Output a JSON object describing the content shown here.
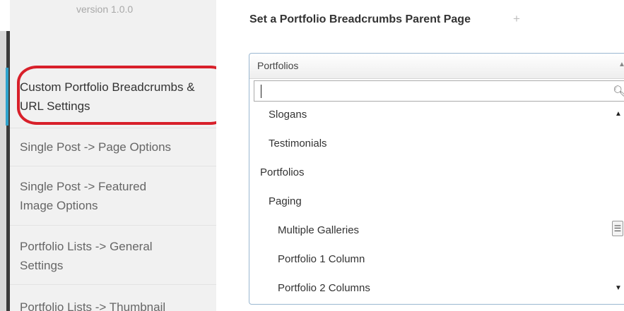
{
  "sidebar": {
    "version": "version 1.0.0",
    "items": [
      {
        "label": "Custom Portfolio Breadcrumbs & URL Settings"
      },
      {
        "label": "Single Post -> Page Options"
      },
      {
        "label": "Single Post -> Featured Image Options"
      },
      {
        "label": "Portfolio Lists -> General Settings"
      },
      {
        "label": "Portfolio Lists -> Thumbnail"
      }
    ]
  },
  "main": {
    "setting_title": "Set a Portfolio Breadcrumbs Parent Page",
    "plus": "+",
    "select": {
      "selected_value": "Portfolios",
      "search_value": "",
      "options": [
        "Slogans",
        "Testimonials",
        "Portfolios",
        "Paging",
        "Multiple Galleries",
        "Portfolio 1 Column",
        "Portfolio 2 Columns"
      ]
    }
  },
  "colors": {
    "highlight_ring": "#d8202a",
    "active_bar": "#2ea2cc"
  }
}
